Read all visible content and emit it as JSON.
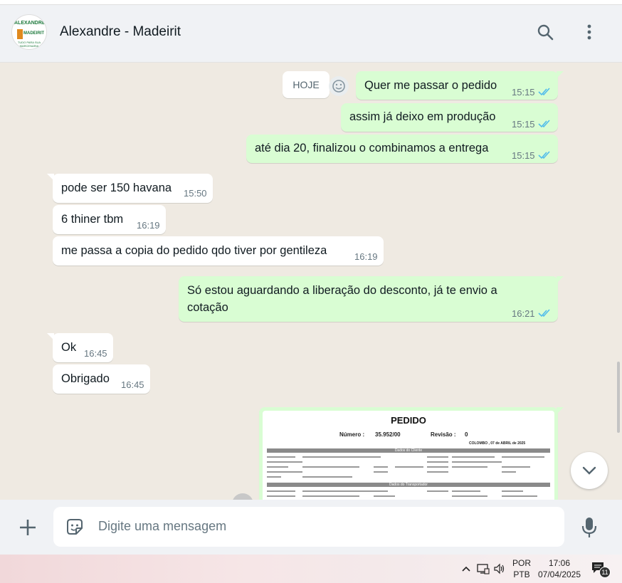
{
  "header": {
    "contact_name": "Alexandre - Madeirit",
    "avatar": {
      "brand_top": "ALEXANDRE",
      "brand_mid": "MADEIRIT",
      "brand_bottom": "TUDO PARA SUA MARCENARIA"
    },
    "search_icon": "search-icon",
    "menu_icon": "kebab-menu-icon"
  },
  "chat": {
    "date_chip": "HOJE",
    "messages": [
      {
        "dir": "out",
        "text": "Quer me passar o pedido",
        "time": "15:15",
        "status": "read"
      },
      {
        "dir": "out",
        "text": "assim já deixo em produção",
        "time": "15:15",
        "status": "read"
      },
      {
        "dir": "out",
        "text": "até dia 20, finalizou o combinamos a entrega",
        "time": "15:15",
        "status": "read"
      },
      {
        "dir": "in",
        "text": "pode ser 150 havana",
        "time": "15:50"
      },
      {
        "dir": "in",
        "text": "6 thiner tbm",
        "time": "16:19"
      },
      {
        "dir": "in",
        "text": "me passa a copia do pedido qdo tiver por gentileza",
        "time": "16:19"
      },
      {
        "dir": "out",
        "text_line1": "Só estou aguardando a liberação do desconto, já te envio a",
        "text_line2": "cotação",
        "time": "16:21",
        "status": "read"
      },
      {
        "dir": "in",
        "text": "Ok",
        "time": "16:45"
      },
      {
        "dir": "in",
        "text": "Obrigado",
        "time": "16:45"
      }
    ],
    "document": {
      "title": "PEDIDO",
      "numero_label": "Número :",
      "numero_value": "35.952/00",
      "revisao_label": "Revisão :",
      "revisao_value": "0",
      "city_date": "COLOMBO , 07 de ABRIL de 2025",
      "band_cliente": "Dados do Cliente",
      "band_transportador": "Dados do Transportador"
    },
    "read_tick_color": "#53bdeb"
  },
  "composer": {
    "placeholder": "Digite uma mensagem",
    "attach_icon": "plus-icon",
    "sticker_icon": "sticker-icon",
    "mic_icon": "microphone-icon"
  },
  "taskbar": {
    "lang_line1": "POR",
    "lang_line2": "PTB",
    "time": "17:06",
    "date": "07/04/2025",
    "notification_count": "11"
  }
}
